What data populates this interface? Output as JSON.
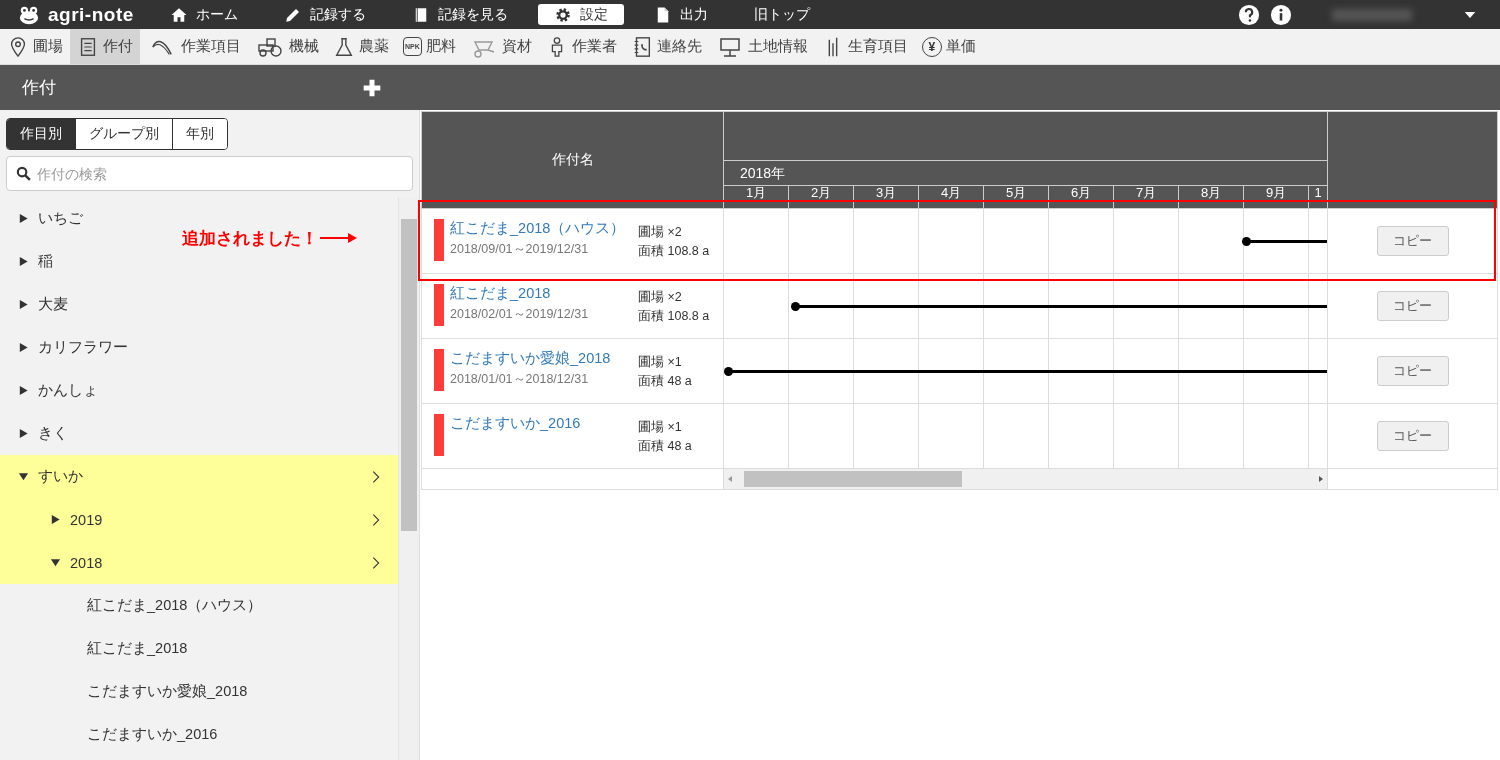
{
  "top_nav": {
    "logo": "agri-note",
    "items": [
      {
        "label": "ホーム",
        "selected": false
      },
      {
        "label": "記録する",
        "selected": false
      },
      {
        "label": "記録を見る",
        "selected": false
      },
      {
        "label": "設定",
        "selected": true
      },
      {
        "label": "出力",
        "selected": false
      },
      {
        "label": "旧トップ",
        "selected": false
      }
    ]
  },
  "toolbar": {
    "items": [
      {
        "label": "圃場",
        "selected": false
      },
      {
        "label": "作付",
        "selected": true
      },
      {
        "label": "作業項目",
        "selected": false
      },
      {
        "label": "機械",
        "selected": false
      },
      {
        "label": "農薬",
        "selected": false
      },
      {
        "label": "肥料",
        "selected": false,
        "badge": "NPK"
      },
      {
        "label": "資材",
        "selected": false
      },
      {
        "label": "作業者",
        "selected": false
      },
      {
        "label": "連絡先",
        "selected": false
      },
      {
        "label": "土地情報",
        "selected": false
      },
      {
        "label": "生育項目",
        "selected": false
      },
      {
        "label": "単価",
        "selected": false,
        "badge": "¥"
      }
    ]
  },
  "panel": {
    "title": "作付"
  },
  "sidebar": {
    "tabs": [
      {
        "label": "作目別",
        "selected": true
      },
      {
        "label": "グループ別",
        "selected": false
      },
      {
        "label": "年別",
        "selected": false
      }
    ],
    "search": {
      "placeholder": "作付の検索"
    },
    "tree": [
      {
        "label": "いちご",
        "expanded": false,
        "highlighted": false
      },
      {
        "label": "稲",
        "expanded": false,
        "highlighted": false
      },
      {
        "label": "大麦",
        "expanded": false,
        "highlighted": false
      },
      {
        "label": "カリフラワー",
        "expanded": false,
        "highlighted": false
      },
      {
        "label": "かんしょ",
        "expanded": false,
        "highlighted": false
      },
      {
        "label": "きく",
        "expanded": false,
        "highlighted": false
      },
      {
        "label": "すいか",
        "expanded": true,
        "highlighted": true,
        "children": [
          {
            "label": "2019",
            "expanded": false,
            "highlighted": true
          },
          {
            "label": "2018",
            "expanded": true,
            "highlighted": true,
            "children": [
              {
                "label": "紅こだま_2018（ハウス）"
              },
              {
                "label": "紅こだま_2018"
              },
              {
                "label": "こだますいか愛娘_2018"
              },
              {
                "label": "こだますいか_2016"
              }
            ]
          }
        ]
      }
    ]
  },
  "table": {
    "name_header": "作付名",
    "year": "2018年",
    "months": [
      "1月",
      "2月",
      "3月",
      "4月",
      "5月",
      "6月",
      "7月",
      "8月",
      "9月",
      "1"
    ],
    "rows": [
      {
        "name": "紅こだま_2018（ハウス）",
        "period": "2018/09/01～2019/12/31",
        "fields": "圃場 ×2",
        "area": "面積 108.8 a",
        "color": "#ff3b3b",
        "timeline": {
          "level": 0.136
        },
        "button": "コピー"
      },
      {
        "name": "紅こだま_2018",
        "period": "2018/02/01～2019/12/31",
        "fields": "圃場 ×2",
        "area": "面積 108.8 a",
        "color": "#ff3b3b",
        "timeline": {
          "level": 0.889
        },
        "button": "コピー"
      },
      {
        "name": "こだますいか愛娘_2018",
        "period": "2018/01/01～2018/12/31",
        "fields": "圃場 ×1",
        "area": "面積 48 a",
        "color": "#ff3b3b",
        "timeline": {
          "level": 1.0
        },
        "button": "コピー"
      },
      {
        "name": "こだますいか_2016",
        "fields": "圃場 ×1",
        "area": "面積 48 a",
        "color": "#ff3b3b",
        "button": "コピー"
      }
    ]
  },
  "annotation": {
    "text": "追加されました！"
  }
}
